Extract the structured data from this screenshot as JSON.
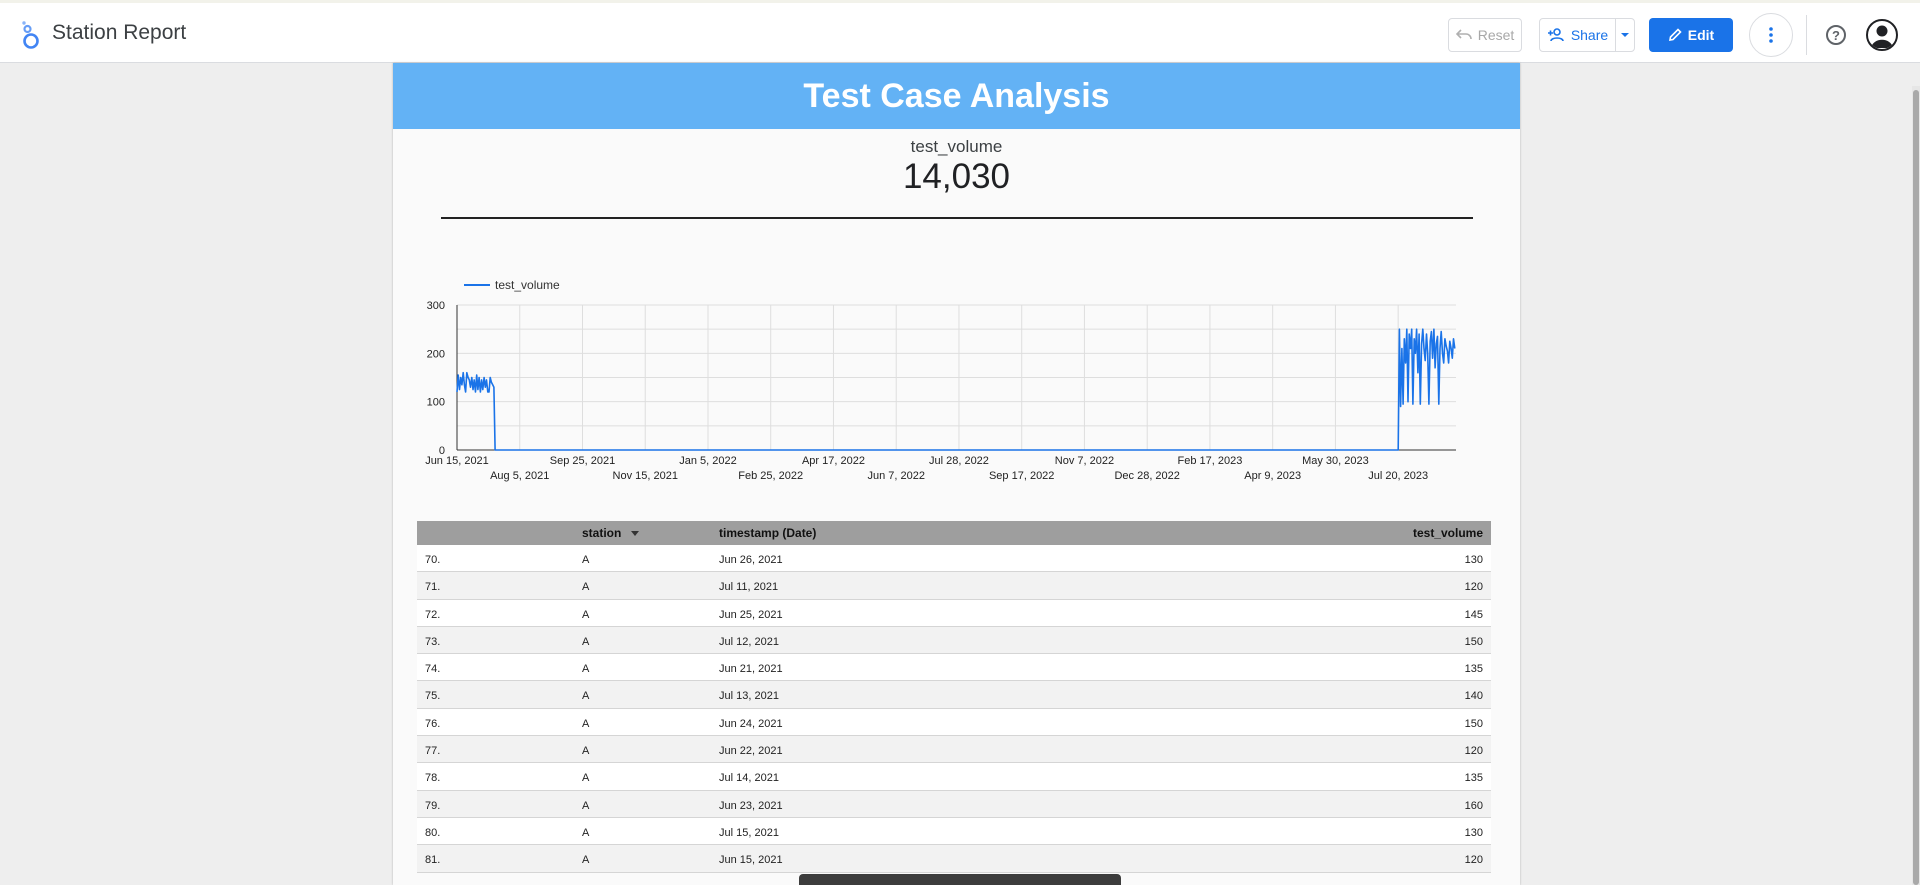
{
  "header": {
    "app_title": "Station Report",
    "reset_label": "Reset",
    "share_label": "Share",
    "edit_label": "Edit"
  },
  "report": {
    "banner_title": "Test Case Analysis",
    "scorecard": {
      "label": "test_volume",
      "value": "14,030"
    }
  },
  "chart_data": {
    "type": "line",
    "legend": [
      "test_volume"
    ],
    "legend_position": "top-left",
    "ylim": [
      0,
      300
    ],
    "yticks": [
      "0",
      "100",
      "200",
      "300"
    ],
    "xlim": [
      "2021-06-15",
      "2023-09-05"
    ],
    "xticks_row1": [
      "Jun 15, 2021",
      "Sep 25, 2021",
      "Jan 5, 2022",
      "Apr 17, 2022",
      "Jul 28, 2022",
      "Nov 7, 2022",
      "Feb 17, 2023",
      "May 30, 2023"
    ],
    "xticks_row2": [
      "Aug 5, 2021",
      "Nov 15, 2021",
      "Feb 25, 2022",
      "Jun 7, 2022",
      "Sep 17, 2022",
      "Dec 28, 2022",
      "Apr 9, 2023",
      "Jul 20, 2023"
    ],
    "grid": true,
    "color": "#1a73e8",
    "series": [
      {
        "name": "test_volume",
        "x": [
          "2021-06-15",
          "2021-06-16",
          "2021-06-17",
          "2021-06-18",
          "2021-06-19",
          "2021-06-20",
          "2021-06-21",
          "2021-06-22",
          "2021-06-23",
          "2021-06-24",
          "2021-06-25",
          "2021-06-26",
          "2021-06-27",
          "2021-06-28",
          "2021-06-29",
          "2021-06-30",
          "2021-07-01",
          "2021-07-02",
          "2021-07-03",
          "2021-07-04",
          "2021-07-05",
          "2021-07-06",
          "2021-07-07",
          "2021-07-08",
          "2021-07-09",
          "2021-07-10",
          "2021-07-11",
          "2021-07-12",
          "2021-07-13",
          "2021-07-14",
          "2021-07-15",
          "2021-07-16",
          "2023-07-20",
          "2023-07-21",
          "2023-07-22",
          "2023-07-23",
          "2023-07-24",
          "2023-07-25",
          "2023-07-26",
          "2023-07-27",
          "2023-07-28",
          "2023-07-29",
          "2023-07-30",
          "2023-07-31",
          "2023-08-01",
          "2023-08-02",
          "2023-08-03",
          "2023-08-04",
          "2023-08-05",
          "2023-08-06",
          "2023-08-07",
          "2023-08-08",
          "2023-08-09",
          "2023-08-10",
          "2023-08-11",
          "2023-08-12",
          "2023-08-13",
          "2023-08-14",
          "2023-08-15",
          "2023-08-16",
          "2023-08-17",
          "2023-08-18",
          "2023-08-19",
          "2023-08-20",
          "2023-08-21",
          "2023-08-22",
          "2023-08-23",
          "2023-08-24",
          "2023-08-25",
          "2023-08-26",
          "2023-08-27",
          "2023-08-28",
          "2023-08-29",
          "2023-08-30",
          "2023-08-31",
          "2023-09-01",
          "2023-09-02",
          "2023-09-03",
          "2023-09-04"
        ],
        "y": [
          120,
          155,
          125,
          150,
          135,
          160,
          135,
          120,
          160,
          150,
          145,
          130,
          150,
          125,
          145,
          120,
          155,
          125,
          150,
          120,
          145,
          125,
          150,
          130,
          145,
          120,
          120,
          150,
          140,
          135,
          130,
          0,
          0,
          250,
          90,
          210,
          95,
          230,
          180,
          250,
          100,
          240,
          210,
          250,
          95,
          230,
          200,
          250,
          160,
          240,
          95,
          220,
          250,
          210,
          185,
          240,
          200,
          95,
          225,
          245,
          190,
          250,
          170,
          220,
          235,
          95,
          210,
          245,
          200,
          180,
          230,
          215,
          205,
          180,
          225,
          210,
          190,
          230,
          210
        ]
      }
    ]
  },
  "table": {
    "columns": [
      "",
      "station",
      "timestamp (Date)",
      "test_volume"
    ],
    "rows": [
      [
        "70.",
        "A",
        "Jun 26, 2021",
        "130"
      ],
      [
        "71.",
        "A",
        "Jul 11, 2021",
        "120"
      ],
      [
        "72.",
        "A",
        "Jun 25, 2021",
        "145"
      ],
      [
        "73.",
        "A",
        "Jul 12, 2021",
        "150"
      ],
      [
        "74.",
        "A",
        "Jun 21, 2021",
        "135"
      ],
      [
        "75.",
        "A",
        "Jul 13, 2021",
        "140"
      ],
      [
        "76.",
        "A",
        "Jun 24, 2021",
        "150"
      ],
      [
        "77.",
        "A",
        "Jun 22, 2021",
        "120"
      ],
      [
        "78.",
        "A",
        "Jul 14, 2021",
        "135"
      ],
      [
        "79.",
        "A",
        "Jun 23, 2021",
        "160"
      ],
      [
        "80.",
        "A",
        "Jul 15, 2021",
        "130"
      ],
      [
        "81.",
        "A",
        "Jun 15, 2021",
        "120"
      ]
    ]
  }
}
